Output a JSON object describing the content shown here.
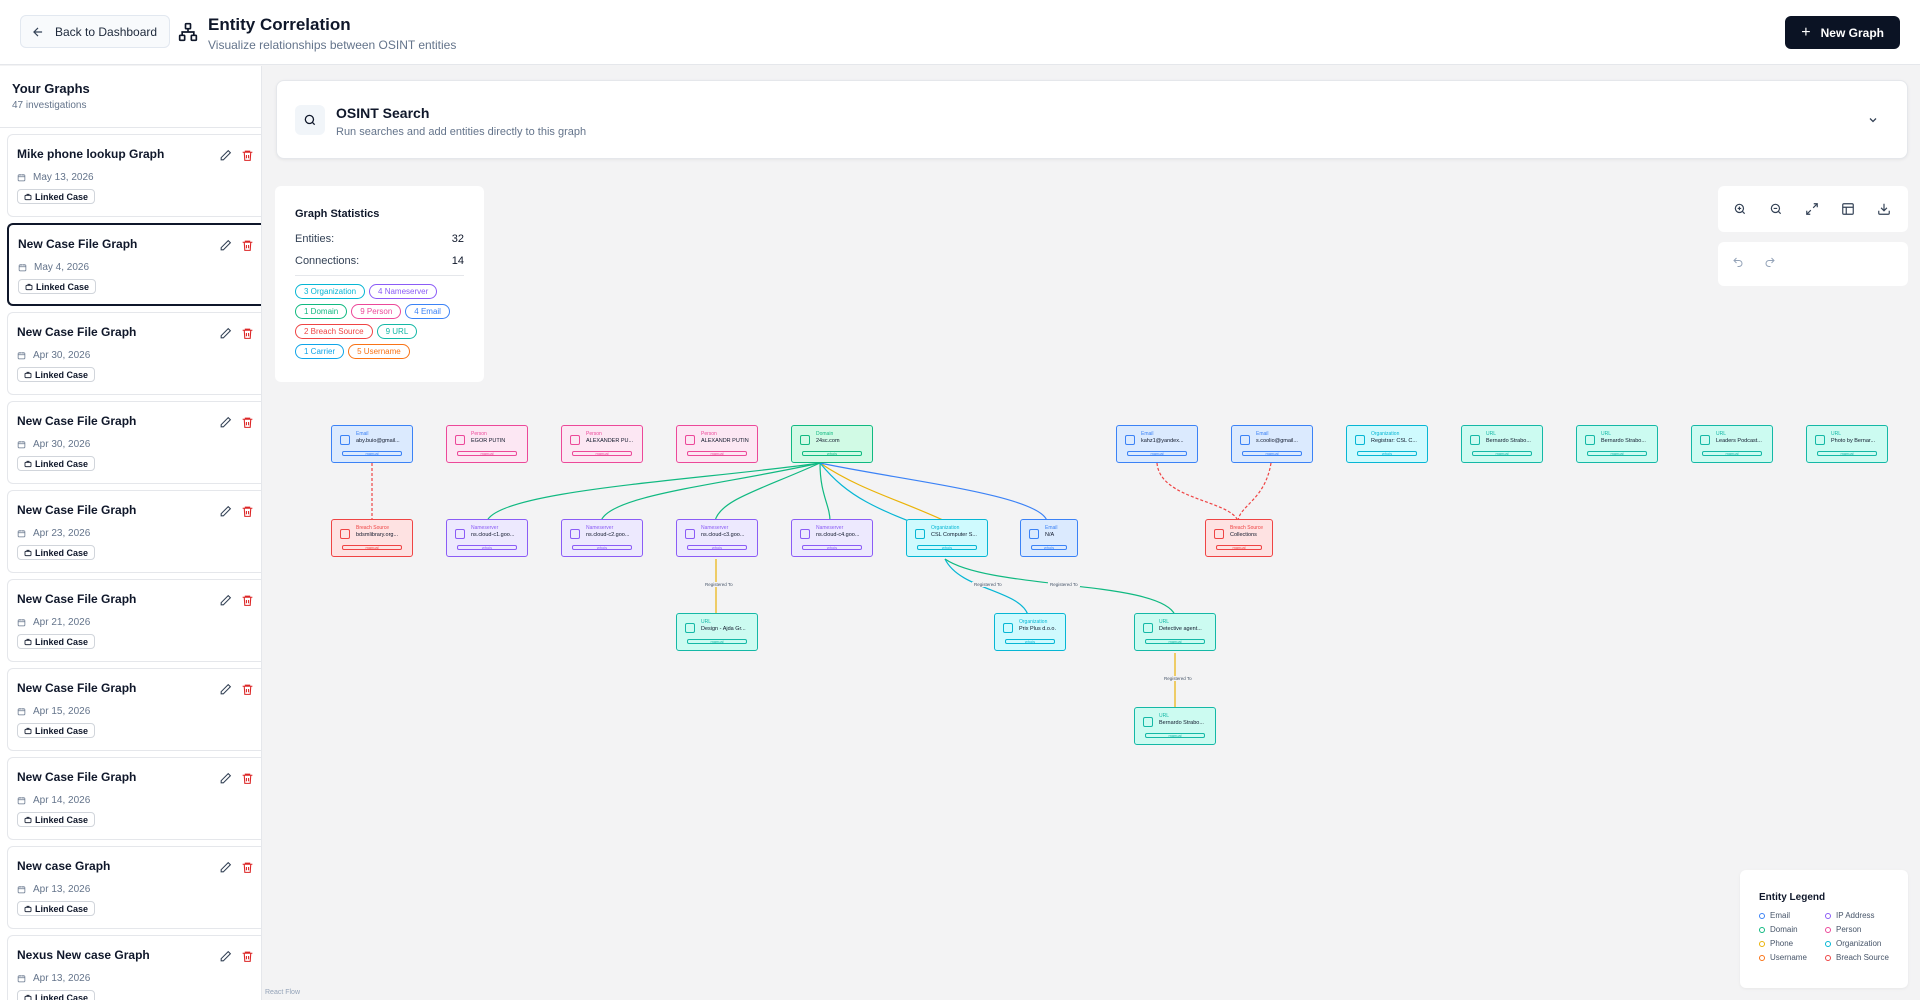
{
  "header": {
    "back_label": "Back to Dashboard",
    "title": "Entity Correlation",
    "subtitle": "Visualize relationships between OSINT entities",
    "new_graph_label": "New Graph"
  },
  "sidebar": {
    "title": "Your Graphs",
    "count": "47 investigations",
    "badge_label": "Linked Case",
    "graphs": [
      {
        "name": "Mike phone lookup Graph",
        "date": "May 13, 2026"
      },
      {
        "name": "New Case File Graph",
        "date": "May 4, 2026",
        "active": true
      },
      {
        "name": "New Case File Graph",
        "date": "Apr 30, 2026"
      },
      {
        "name": "New Case File Graph",
        "date": "Apr 30, 2026"
      },
      {
        "name": "New Case File Graph",
        "date": "Apr 23, 2026"
      },
      {
        "name": "New Case File Graph",
        "date": "Apr 21, 2026"
      },
      {
        "name": "New Case File Graph",
        "date": "Apr 15, 2026"
      },
      {
        "name": "New Case File Graph",
        "date": "Apr 14, 2026"
      },
      {
        "name": "New case Graph",
        "date": "Apr 13, 2026"
      },
      {
        "name": "Nexus New case Graph",
        "date": "Apr 13, 2026"
      }
    ]
  },
  "search": {
    "title": "OSINT Search",
    "subtitle": "Run searches and add entities directly to this graph"
  },
  "stats": {
    "title": "Graph Statistics",
    "entities_label": "Entities:",
    "entities_value": "32",
    "connections_label": "Connections:",
    "connections_value": "14",
    "chips": [
      {
        "text": "3 Organization",
        "color": "#06b6d4"
      },
      {
        "text": "4 Nameserver",
        "color": "#8b5cf6"
      },
      {
        "text": "1 Domain",
        "color": "#10b981"
      },
      {
        "text": "9 Person",
        "color": "#ec4899"
      },
      {
        "text": "4 Email",
        "color": "#3b82f6"
      },
      {
        "text": "2 Breach Source",
        "color": "#ef4444"
      },
      {
        "text": "9 URL",
        "color": "#14b8a6"
      },
      {
        "text": "1 Carrier",
        "color": "#0ea5e9"
      },
      {
        "text": "5 Username",
        "color": "#f97316"
      }
    ]
  },
  "legend": {
    "title": "Entity Legend",
    "items": [
      {
        "label": "Email",
        "color": "#3b82f6"
      },
      {
        "label": "IP Address",
        "color": "#8b5cf6"
      },
      {
        "label": "Domain",
        "color": "#10b981"
      },
      {
        "label": "Person",
        "color": "#ec4899"
      },
      {
        "label": "Phone",
        "color": "#eab308"
      },
      {
        "label": "Organization",
        "color": "#06b6d4"
      },
      {
        "label": "Username",
        "color": "#f97316"
      },
      {
        "label": "Breach Source",
        "color": "#ef4444"
      }
    ]
  },
  "attribution": "React Flow",
  "graph": {
    "nodes": [
      {
        "type": "Email",
        "value": "aby.buio@gmail...",
        "tag": "manual",
        "kind": "email"
      },
      {
        "type": "Person",
        "value": "EGOR PUTIN",
        "tag": "manual",
        "kind": "person"
      },
      {
        "type": "Person",
        "value": "ALEXANDER PU...",
        "tag": "manual",
        "kind": "person"
      },
      {
        "type": "Person",
        "value": "ALEXANDR PUTIN",
        "tag": "manual",
        "kind": "person"
      },
      {
        "type": "Domain",
        "value": "24sc.com",
        "tag": "whois",
        "kind": "domain"
      },
      {
        "type": "Email",
        "value": "kahz1@yandex...",
        "tag": "manual",
        "kind": "email"
      },
      {
        "type": "Email",
        "value": "s.coolio@gmail...",
        "tag": "manual",
        "kind": "email"
      },
      {
        "type": "Organization",
        "value": "Registrar: CSL C...",
        "tag": "whois",
        "kind": "org"
      },
      {
        "type": "URL",
        "value": "Bernardo Štrabo...",
        "tag": "manual",
        "kind": "url"
      },
      {
        "type": "URL",
        "value": "Bernardo Štrabo...",
        "tag": "manual",
        "kind": "url"
      },
      {
        "type": "URL",
        "value": "Leaders Podcast...",
        "tag": "manual",
        "kind": "url"
      },
      {
        "type": "URL",
        "value": "Photo by Bernar...",
        "tag": "manual",
        "kind": "url"
      },
      {
        "type": "Breach Source",
        "value": "bdsmlibrary.org...",
        "tag": "manual",
        "kind": "breach"
      },
      {
        "type": "Nameserver",
        "value": "ns.cloud-c1.goo...",
        "tag": "whois",
        "kind": "ns"
      },
      {
        "type": "Nameserver",
        "value": "ns.cloud-c2.goo...",
        "tag": "whois",
        "kind": "ns"
      },
      {
        "type": "Nameserver",
        "value": "ns.cloud-c3.goo...",
        "tag": "whois",
        "kind": "ns"
      },
      {
        "type": "Nameserver",
        "value": "ns.cloud-c4.goo...",
        "tag": "whois",
        "kind": "ns"
      },
      {
        "type": "Organization",
        "value": "CSL Computer S...",
        "tag": "whois",
        "kind": "org"
      },
      {
        "type": "Email",
        "value": "N/A",
        "tag": "whois",
        "kind": "email"
      },
      {
        "type": "Breach Source",
        "value": "Collections",
        "tag": "manual",
        "kind": "breach"
      },
      {
        "type": "URL",
        "value": "Design - Ajda Gr...",
        "tag": "manual",
        "kind": "url"
      },
      {
        "type": "Organization",
        "value": "Prix Plus d.o.o.",
        "tag": "whois",
        "kind": "org"
      },
      {
        "type": "URL",
        "value": "Detective agent...",
        "tag": "manual",
        "kind": "url"
      },
      {
        "type": "URL",
        "value": "Bernardo Štrabo...",
        "tag": "manual",
        "kind": "url"
      }
    ],
    "edge_labels": [
      "Registered To",
      "Registered To",
      "Registered To",
      "Registered To"
    ]
  },
  "colors": {
    "email": "#3b82f6",
    "person": "#ec4899",
    "domain": "#10b981",
    "org": "#06b6d4",
    "url": "#14b8a6",
    "breach": "#ef4444",
    "ns": "#8b5cf6",
    "phone": "#eab308"
  }
}
